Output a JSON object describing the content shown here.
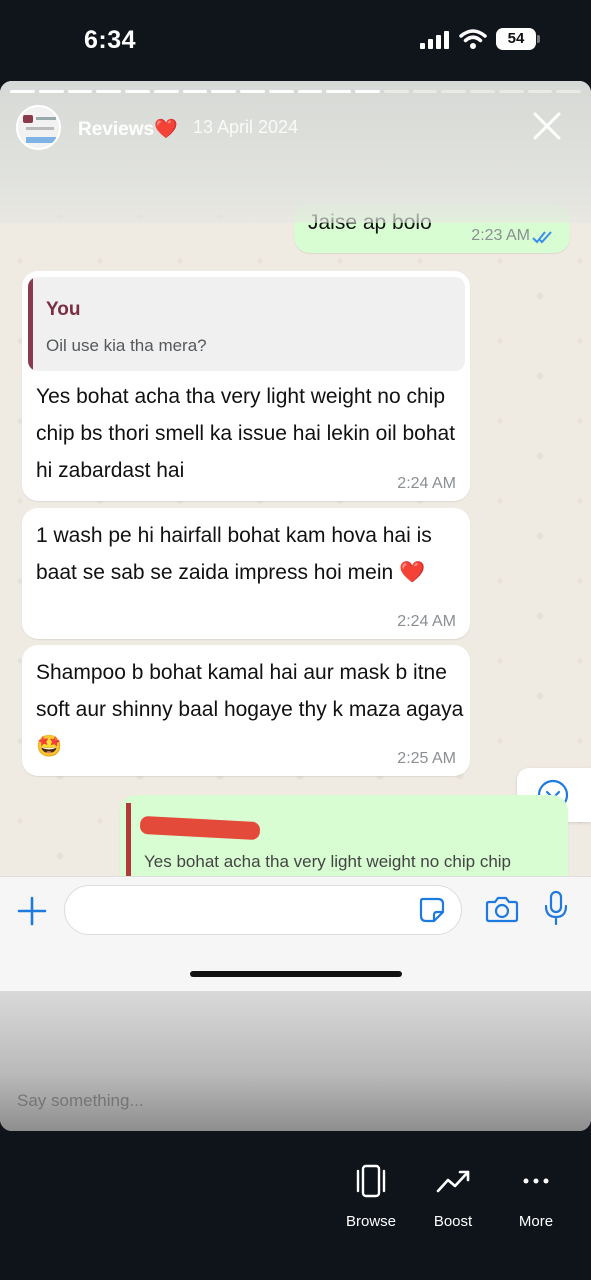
{
  "status_bar": {
    "time": "6:34",
    "battery": "54"
  },
  "story": {
    "name": "Reviews❤️",
    "date": "13 April 2024",
    "progress_segments_total": 20,
    "progress_segments_done": 13
  },
  "chat": {
    "top_message": {
      "text": "Jaise ap bolo",
      "time": "2:23 AM"
    },
    "messages": [
      {
        "quote_author": "You",
        "quote_text": "Oil use kia tha mera?",
        "text": "Yes bohat acha tha very light weight no chip chip bs thori smell ka issue hai lekin oil bohat hi zabardast hai",
        "time": "2:24 AM"
      },
      {
        "text": "1 wash pe hi hairfall bohat kam hova hai is baat se sab se zaida impress hoi mein ❤️",
        "time": "2:24 AM"
      },
      {
        "text": "Shampoo b bohat kamal hai aur mask b itne soft aur shinny baal hogaye thy k maza agaya 🤩",
        "time": "2:25 AM"
      }
    ],
    "reply_preview": {
      "quote_text": "Yes bohat acha tha very light weight no chip chip"
    }
  },
  "composer": {
    "placeholder": ""
  },
  "story_reply": {
    "placeholder": "Say something..."
  },
  "nav": {
    "browse": "Browse",
    "boost": "Boost",
    "more": "More"
  },
  "colors": {
    "accent_blue": "#1f7ae0",
    "outgoing_bubble": "#d9fdd3",
    "quote_bar": "#8a3a4e",
    "background": "#10151c"
  }
}
